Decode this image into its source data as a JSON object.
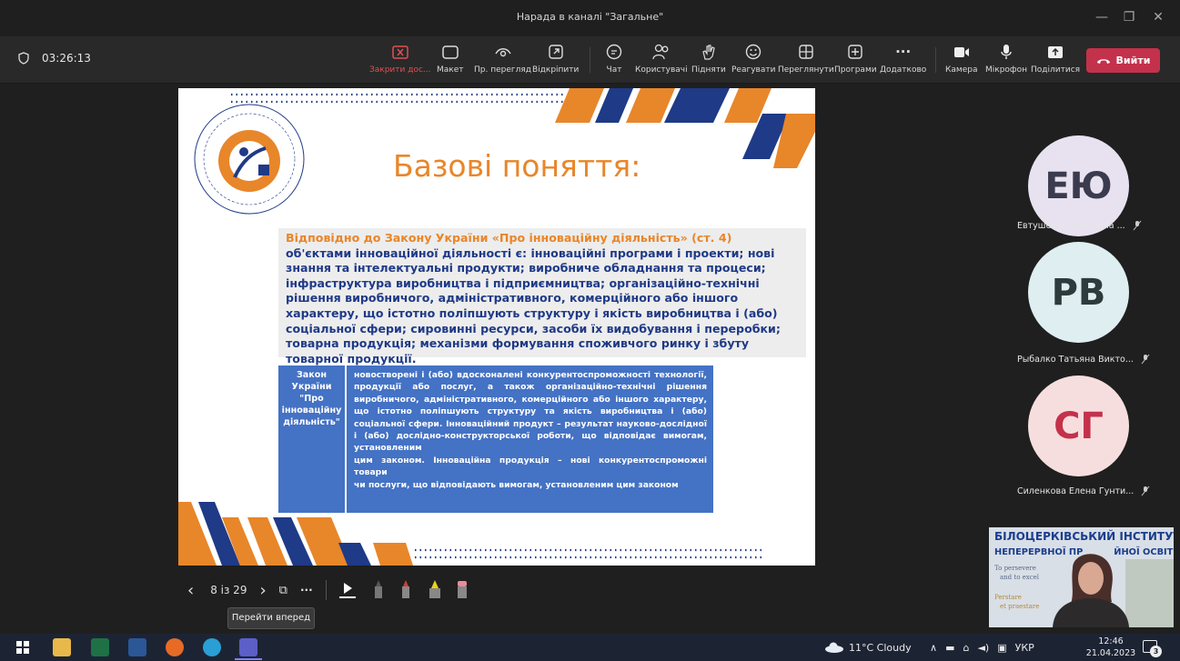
{
  "window": {
    "title": "Нарада в каналі \"Загальне\""
  },
  "meeting": {
    "timer": "03:26:13"
  },
  "toolbar": {
    "buttons": [
      {
        "label": "Закрити дос...",
        "icon": "close-share-icon"
      },
      {
        "label": "Макет",
        "icon": "layout-icon"
      },
      {
        "label": "Пр. перегляд",
        "icon": "eye-icon"
      },
      {
        "label": "Відкріпити",
        "icon": "popout-icon"
      },
      {
        "label": "Чат",
        "icon": "chat-icon"
      },
      {
        "label": "Користувачі",
        "icon": "people-icon"
      },
      {
        "label": "Підняти",
        "icon": "hand-icon"
      },
      {
        "label": "Реагувати",
        "icon": "smile-icon"
      },
      {
        "label": "Переглянути",
        "icon": "view-icon"
      },
      {
        "label": "Програми",
        "icon": "apps-icon"
      },
      {
        "label": "Додатково",
        "icon": "more-icon"
      },
      {
        "label": "Камера",
        "icon": "camera-icon"
      },
      {
        "label": "Мікрофон",
        "icon": "mic-icon"
      },
      {
        "label": "Поділитися",
        "icon": "share-icon"
      }
    ],
    "leave_label": "Вийти"
  },
  "slide": {
    "title": "Базові поняття:",
    "para_orange": "Відповідно до Закону України «Про інноваційну діяльність» (ст. 4)",
    "para_rest": " об'єктами інноваційної діяльності є: інноваційні програми і проекти; нові знання та інтелектуальні продукти; виробниче обладнання та процеси; інфраструктура виробництва і підприємництва; організаційно-технічні рішення виробничого, адміністративного, комерційного або іншого характеру, що істотно поліпшують структуру і якість виробництва і (або) соціальної сфери; сировинні ресурси, засоби їх видобування і переробки; товарна продукція; механізми формування споживчого ринку і збуту товарної продукції.",
    "table_left": "Закон України \"Про інноваційну діяльність\"",
    "table_right_1": "новостворені і (або) вдосконалені конкурентоспроможності технології, продукції або послуг, а також організаційно-технічні рішення виробничого, адміністративного, комерційного або іншого характеру, що істотно поліпшують структуру та якість виробництва і (або) соціальної сфери. Інноваційний продукт – результат науково-дослідної і (або) дослідно-конструкторської роботи, що відповідає вимогам, установленим",
    "table_right_2": "цим законом. Інноваційна продукція – нові конкурентоспроможні товари",
    "table_right_3": "чи послуги, що відповідають вимогам, установленим цим законом"
  },
  "slidenav": {
    "page": "8 із 29",
    "tooltip": "Перейти вперед"
  },
  "participants": [
    {
      "initials": "ЕЮ",
      "name": "Евтушенко Антонина ...",
      "bg": "#e8e2f0"
    },
    {
      "initials": "РВ",
      "name": "Рыбалко Татьяна Викто...",
      "bg": "#dfeef0"
    },
    {
      "initials": "СГ",
      "name": "Силенкова Елена Гунти...",
      "bg": "#f7dede"
    }
  ],
  "video": {
    "line1": "БІЛОЦЕРКІВСЬКИЙ ІНСТИТУТ",
    "line2": "НЕПЕРЕРВНОЇ ПР",
    "line2b": "ЙНОЇ ОСВІТИ",
    "motto1": "To persevere",
    "motto2": "and to excel",
    "motto3": "Perstare",
    "motto4": "et praestare"
  },
  "taskbar": {
    "weather": "11°C Cloudy",
    "lang": "УКР",
    "time": "12:46",
    "date": "21.04.2023",
    "notif": "3"
  },
  "colors": {
    "accent_orange": "#e8862a",
    "slide_blue": "#1f3a86",
    "table_blue": "#4472c4",
    "leave_red": "#c4314b"
  }
}
